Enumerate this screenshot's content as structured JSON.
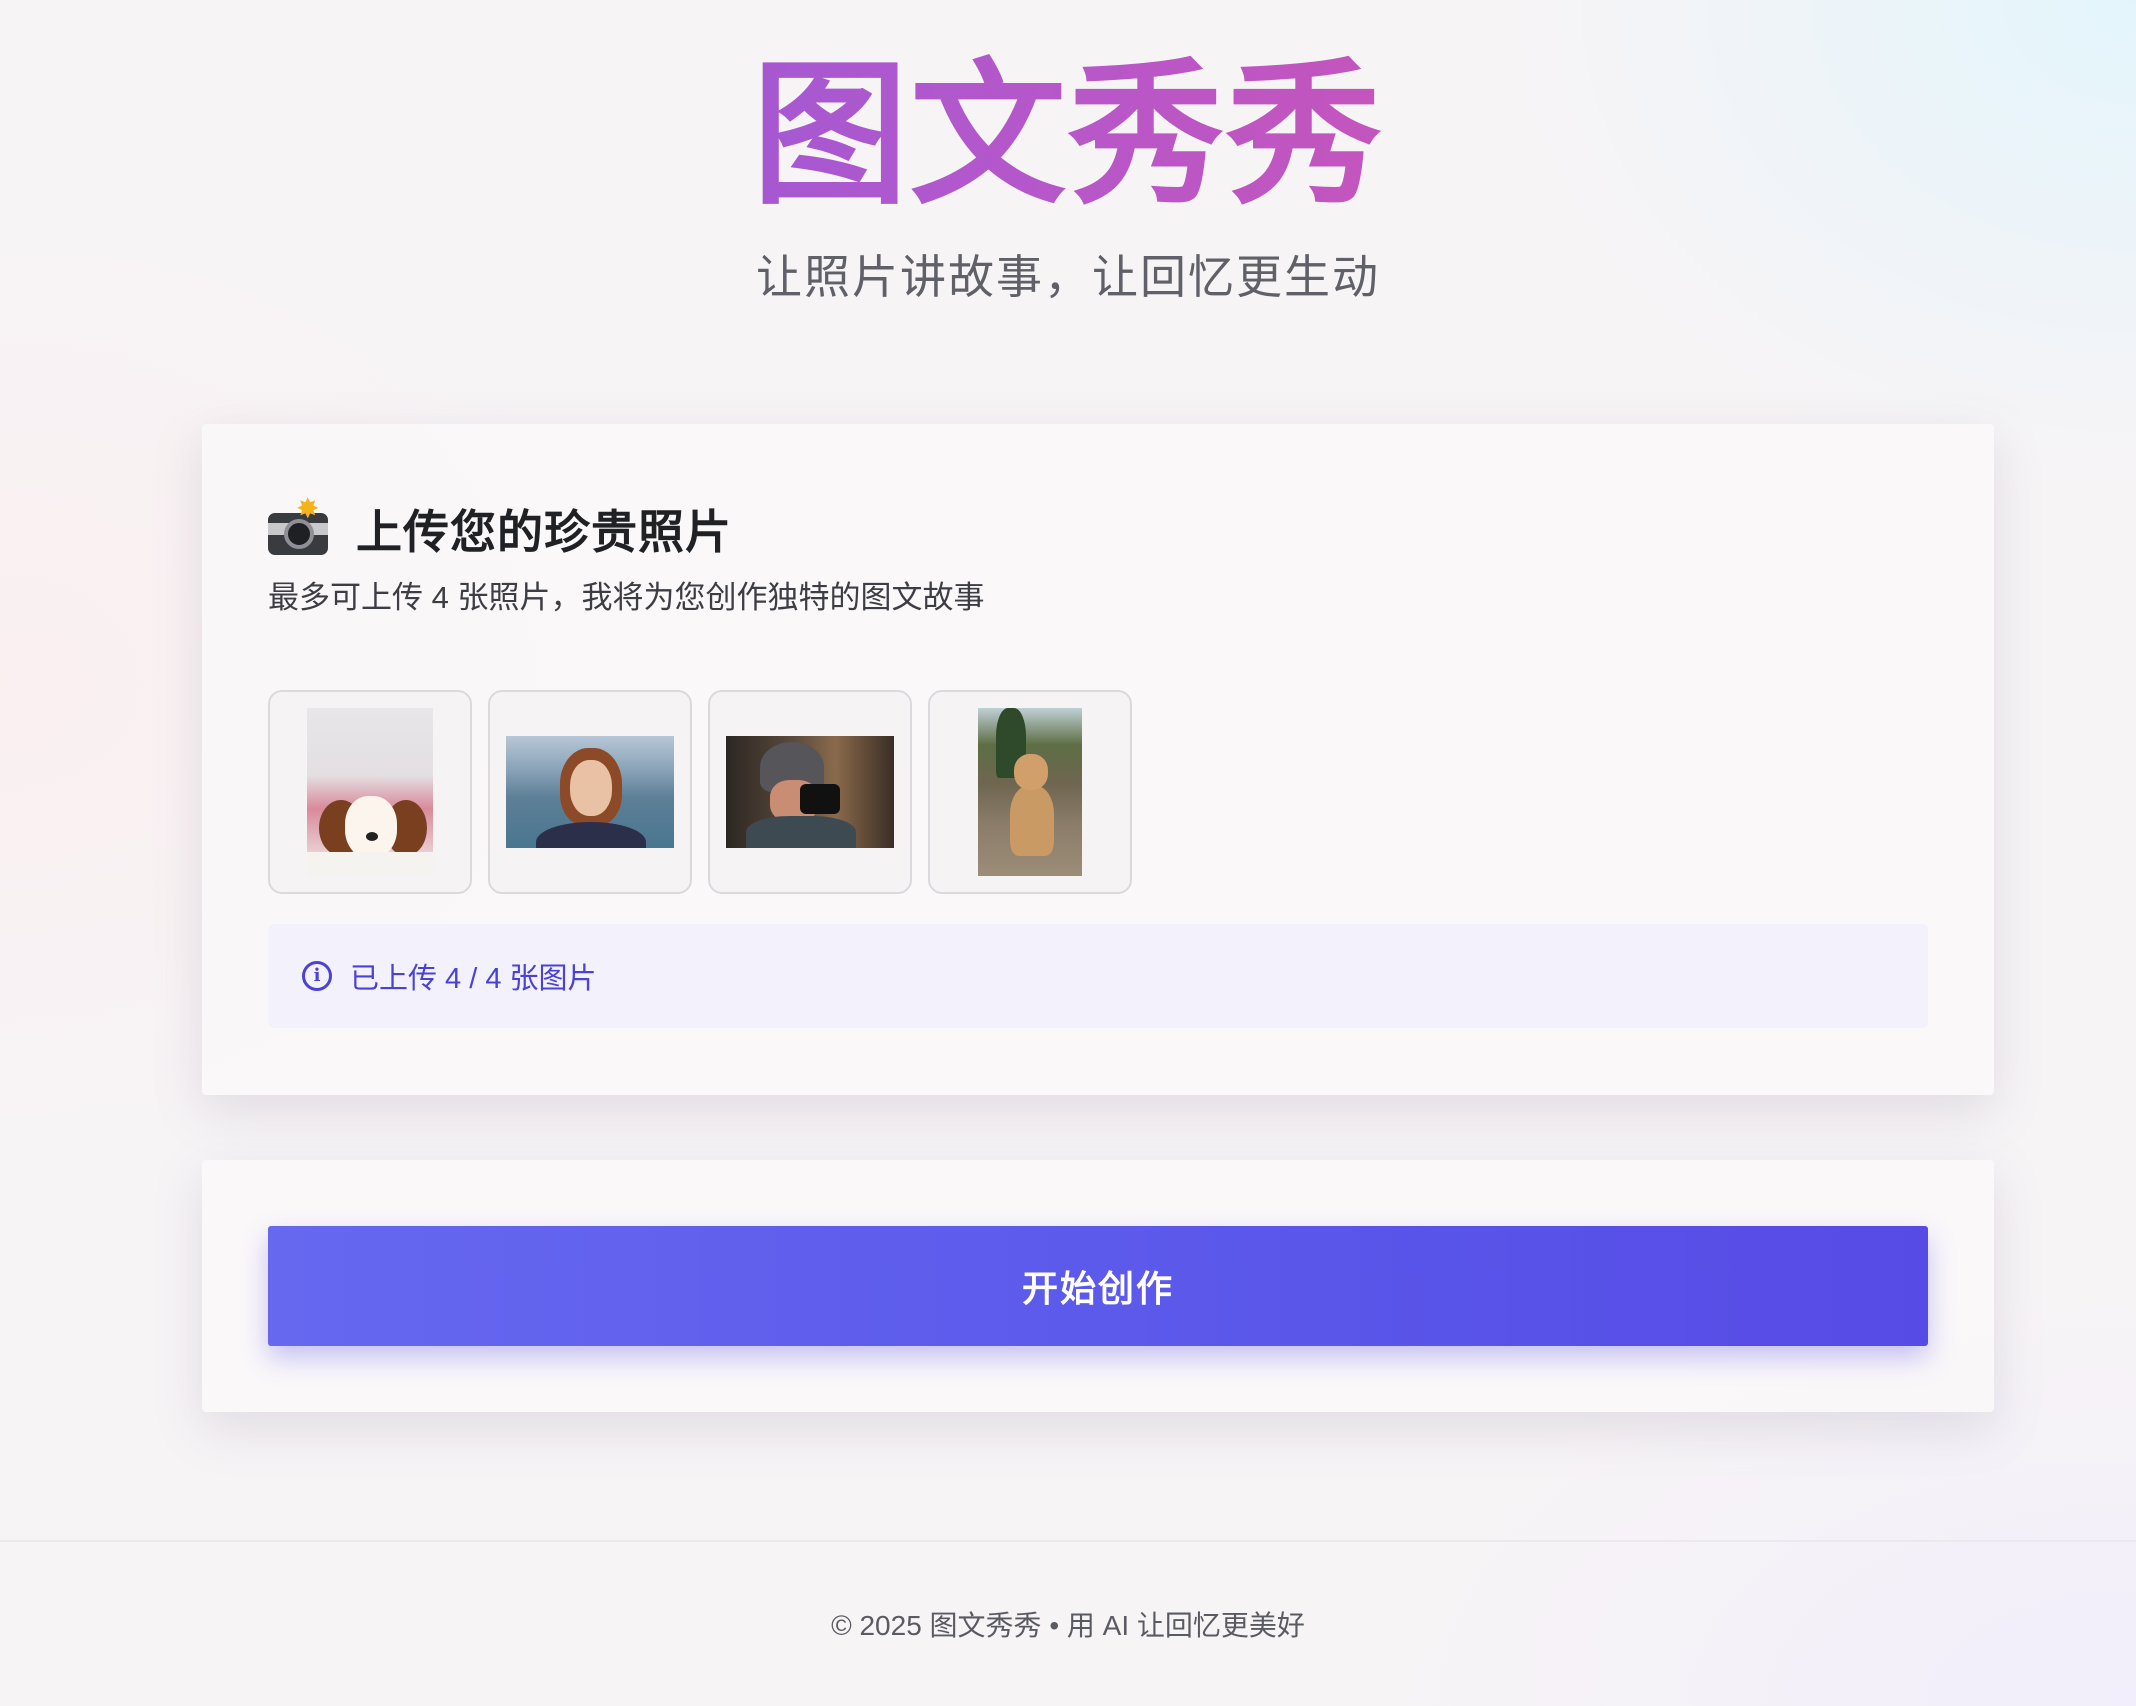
{
  "header": {
    "title": "图文秀秀",
    "subtitle": "让照片讲故事，让回忆更生动"
  },
  "upload": {
    "icon": "camera-flash-icon",
    "title": "上传您的珍贵照片",
    "description": "最多可上传 4 张照片，我将为您创作独特的图文故事",
    "photos": [
      {
        "subject": "puppy-on-pillow"
      },
      {
        "subject": "woman-portrait-lake"
      },
      {
        "subject": "person-with-camera"
      },
      {
        "subject": "golden-dog-sitting"
      }
    ],
    "status_icon": "info-icon",
    "status_text": "已上传 4 / 4 张图片"
  },
  "actions": {
    "start_label": "开始创作"
  },
  "footer": {
    "text": "© 2025 图文秀秀 • 用 AI 让回忆更美好"
  },
  "colors": {
    "accent": "#5b57e9",
    "title_gradient_start": "#7c5ce6",
    "title_gradient_end": "#e24fa0",
    "info_text": "#4a42d6"
  }
}
